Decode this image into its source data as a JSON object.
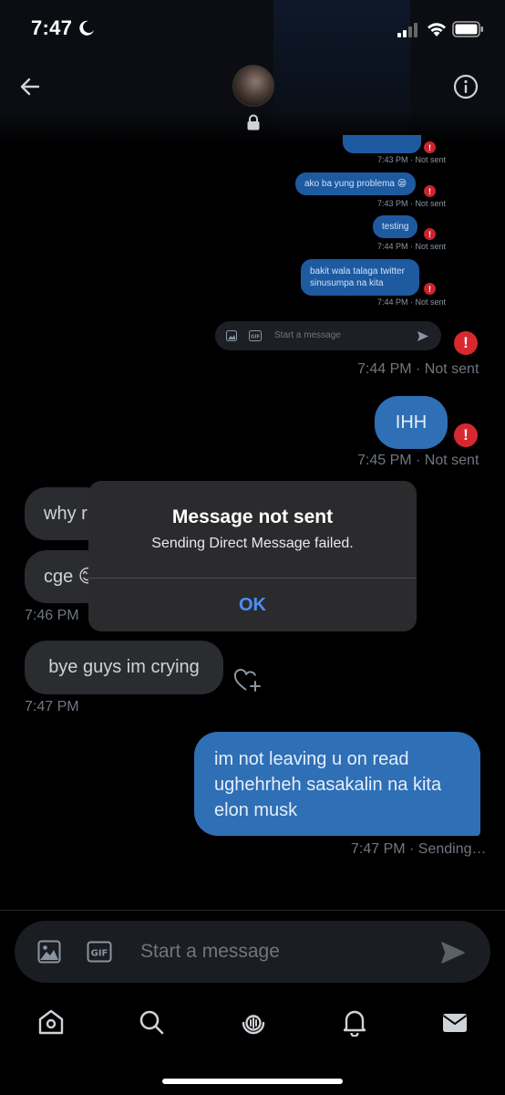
{
  "status_bar": {
    "time": "7:47"
  },
  "embedded_thread": {
    "messages": [
      {
        "text": "ako ba yung problema 😪",
        "meta": "7:43 PM · Not sent"
      },
      {
        "text": "testing",
        "meta": "7:44 PM · Not sent"
      },
      {
        "text": "bakit wala talaga twitter sinusumpa na kita",
        "meta": "7:44 PM · Not sent"
      }
    ],
    "top_meta": "7:43 PM · Not sent",
    "composer_placeholder": "Start a message"
  },
  "messages": [
    {
      "dir": "out",
      "meta": "7:44 PM · Not sent"
    },
    {
      "dir": "out",
      "text": "IHH",
      "meta": "7:45 PM · Not sent"
    },
    {
      "dir": "in",
      "text": "why r",
      "meta": ""
    },
    {
      "dir": "in",
      "text": "cge 😊",
      "meta": "7:46 PM"
    },
    {
      "dir": "in",
      "text": "bye guys im crying",
      "meta": "7:47 PM"
    },
    {
      "dir": "out",
      "text": "im not leaving u on read ughehrheh sasakalin na kita elon musk",
      "meta": "7:47 PM · Sending…"
    }
  ],
  "alert": {
    "title": "Message not sent",
    "message": "Sending Direct Message failed.",
    "button": "OK"
  },
  "composer": {
    "placeholder": "Start a message"
  },
  "colors": {
    "accent": "#4c8ef7",
    "bubble_out": "#2f6fb5",
    "error": "#d8282f"
  }
}
